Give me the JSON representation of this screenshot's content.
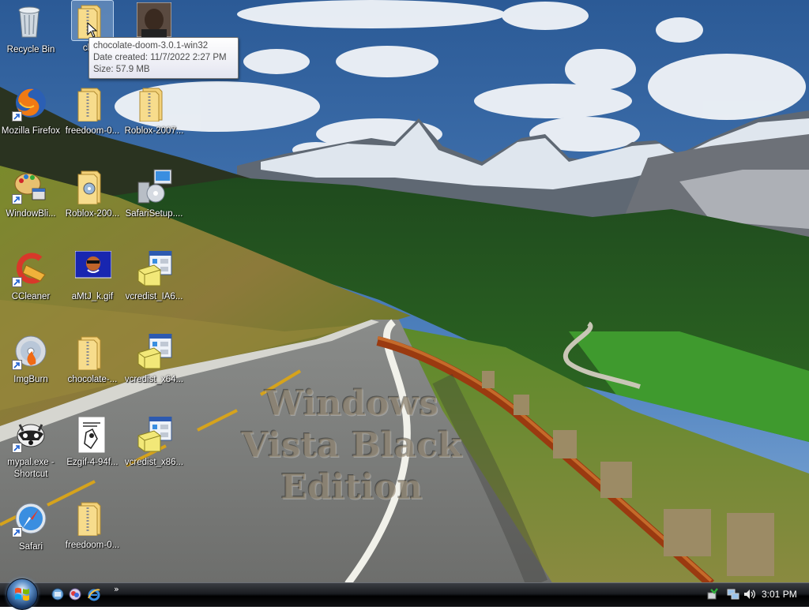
{
  "wallpaper": {
    "watermark_lines": [
      "Windows",
      "Vista Black",
      "Edition"
    ]
  },
  "desktop_icons": [
    {
      "label": "Recycle Bin",
      "icon": "recycle-bin-icon",
      "shortcut": false
    },
    {
      "label": "choc",
      "icon": "zip-folder-icon",
      "shortcut": false
    },
    {
      "label": "",
      "icon": "photo-thumbnail-icon",
      "shortcut": false
    },
    {
      "label": "Mozilla Firefox",
      "icon": "firefox-icon",
      "shortcut": true
    },
    {
      "label": "freedoom-0...",
      "icon": "zip-folder-icon",
      "shortcut": false
    },
    {
      "label": "Roblox-2007...",
      "icon": "zip-folder-icon",
      "shortcut": false
    },
    {
      "label": "WindowBli...",
      "icon": "windowblinds-icon",
      "shortcut": true
    },
    {
      "label": "Roblox-200...",
      "icon": "zip-folder-icon",
      "shortcut": false
    },
    {
      "label": "SafariSetup....",
      "icon": "installer-icon",
      "shortcut": false
    },
    {
      "label": "CCleaner",
      "icon": "ccleaner-icon",
      "shortcut": true
    },
    {
      "label": "aMtJ_k.gif",
      "icon": "gif-image-icon",
      "shortcut": false
    },
    {
      "label": "vcredist_IA6...",
      "icon": "setup-program-icon",
      "shortcut": false
    },
    {
      "label": "ImgBurn",
      "icon": "imgburn-icon",
      "shortcut": true
    },
    {
      "label": "chocolate-...",
      "icon": "zip-folder-icon",
      "shortcut": false
    },
    {
      "label": "vcredist_x64...",
      "icon": "setup-program-icon",
      "shortcut": false
    },
    {
      "label": "mypal.exe - Shortcut",
      "icon": "mypal-icon",
      "shortcut": true
    },
    {
      "label": "Ezgif-4-94f...",
      "icon": "image-document-icon",
      "shortcut": false
    },
    {
      "label": "vcredist_x86...",
      "icon": "setup-program-icon",
      "shortcut": false
    },
    {
      "label": "Safari",
      "icon": "safari-icon",
      "shortcut": true
    },
    {
      "label": "freedoom-0...",
      "icon": "zip-folder-icon",
      "shortcut": false
    }
  ],
  "tooltip": {
    "name": "chocolate-doom-3.0.1-win32",
    "date_created": "Date created: 11/7/2022 2:27 PM",
    "size": "Size: 57.9 MB"
  },
  "taskbar": {
    "start_icon": "windows-logo-icon",
    "quick_launch": [
      "show-desktop-icon",
      "switch-windows-icon",
      "internet-explorer-icon"
    ],
    "overflow_label": "»",
    "tray_icons": [
      "safely-remove-icon",
      "network-icon",
      "volume-icon"
    ],
    "clock": "3:01 PM"
  }
}
